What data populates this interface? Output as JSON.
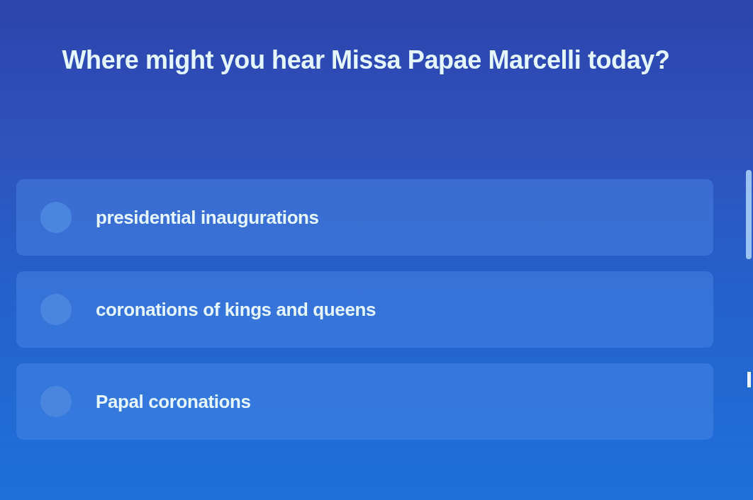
{
  "question": "Where might you hear Missa Papae Marcelli today?",
  "options": [
    {
      "label": "presidential inaugurations",
      "selected": false
    },
    {
      "label": "coronations of kings and queens",
      "selected": false
    },
    {
      "label": "Papal coronations",
      "selected": false
    }
  ]
}
